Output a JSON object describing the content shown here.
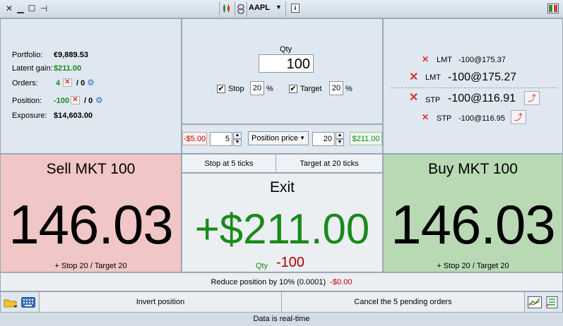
{
  "titlebar": {
    "symbol": "AAPL",
    "icons": [
      "close-icon",
      "minimize-icon",
      "maximize-icon",
      "pin-icon",
      "candlestick-icon",
      "link-icon",
      "info-icon",
      "layout-icon"
    ]
  },
  "summary": {
    "portfolio_label": "Portfolio:",
    "portfolio_value": "€9,889.53",
    "latent_label": "Latent gain:",
    "latent_value": "$211.00",
    "orders_label": "Orders:",
    "orders_count": "4",
    "orders_pending": "/ 0",
    "position_label": "Position:",
    "position_value": "-100",
    "position_pending": "/ 0",
    "exposure_label": "Exposure:",
    "exposure_value": "$14,603.00"
  },
  "order_entry": {
    "qty_label": "Qty",
    "qty_value": "100",
    "stop_label": "Stop",
    "stop_value": "20",
    "target_label": "Target",
    "target_value": "20",
    "percent": "%",
    "stop_amount": "-$5.00",
    "stop_ticks": "5",
    "mode_select": "Position price",
    "target_ticks": "20",
    "target_amount": "$211.00"
  },
  "orders": [
    {
      "type": "LMT",
      "detail": "-100@175.37"
    },
    {
      "type": "LMT",
      "detail": "-100@175.27"
    },
    {
      "type": "STP",
      "detail": "-100@116.91"
    },
    {
      "type": "STP",
      "detail": "-100@116.95"
    }
  ],
  "sell": {
    "title": "Sell MKT 100",
    "price": "146.03",
    "footer": "+ Stop 20 / Target 20"
  },
  "buy": {
    "title": "Buy MKT 100",
    "price": "146.03",
    "footer": "+ Stop 20 / Target 20"
  },
  "exit": {
    "stop_button": "Stop at 5 ticks",
    "target_button": "Target at 20 ticks",
    "title": "Exit",
    "gain": "+$211.00",
    "qty_label": "Qty",
    "qty_value": "-100"
  },
  "reduce": {
    "label": "Reduce position by 10% (0.0001)",
    "amount": "-$0.00"
  },
  "actions": {
    "invert": "Invert position",
    "cancel": "Cancel the 5 pending orders"
  },
  "status": "Data is real-time",
  "colors": {
    "sell_bg": "#f1c6c6",
    "buy_bg": "#b9d9b4",
    "gain_green": "#1a8a1a",
    "loss_red": "#b00000"
  }
}
